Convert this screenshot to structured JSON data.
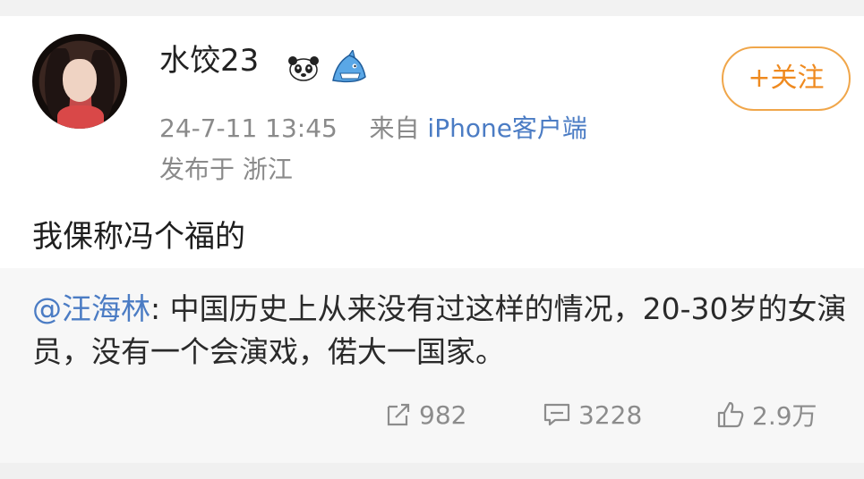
{
  "post": {
    "username": "水饺23",
    "badges": [
      "panda-badge-icon",
      "shark-badge-icon"
    ],
    "timestamp": "24-7-11 13:45",
    "source_prefix": "来自",
    "source": "iPhone客户端",
    "location": "发布于 浙江",
    "follow_label": "+关注",
    "text": "我倮称冯个福的"
  },
  "repost": {
    "mention": "@汪海林",
    "text": ": 中国历史上从来没有过这样的情况，20-30岁的女演员，没有一个会演戏，偌大一国家。"
  },
  "actions": {
    "share_count": "982",
    "comment_count": "3228",
    "like_count": "2.9万"
  },
  "colors": {
    "link": "#4b7cc4",
    "follow": "#ef8a1f",
    "muted": "#8a8a8a"
  }
}
